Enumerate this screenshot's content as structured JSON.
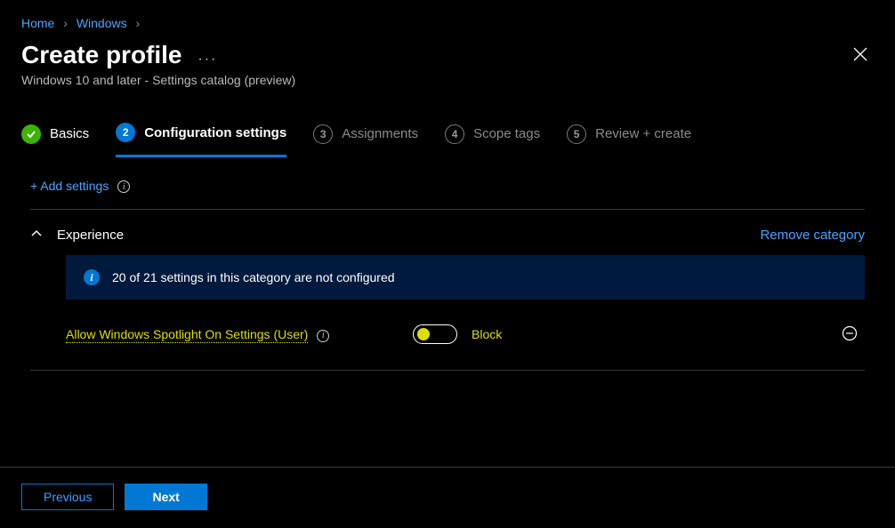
{
  "breadcrumb": {
    "items": [
      "Home",
      "Windows"
    ]
  },
  "header": {
    "title": "Create profile",
    "subtitle": "Windows 10 and later - Settings catalog (preview)"
  },
  "wizard": {
    "steps": [
      {
        "label": "Basics",
        "state": "done"
      },
      {
        "label": "Configuration settings",
        "state": "active",
        "number": "2"
      },
      {
        "label": "Assignments",
        "state": "pending",
        "number": "3"
      },
      {
        "label": "Scope tags",
        "state": "pending",
        "number": "4"
      },
      {
        "label": "Review + create",
        "state": "pending",
        "number": "5"
      }
    ]
  },
  "actions": {
    "add_settings": "+ Add settings"
  },
  "category": {
    "name": "Experience",
    "remove_label": "Remove category",
    "banner": "20 of 21 settings in this category are not configured",
    "settings": [
      {
        "label": "Allow Windows Spotlight On Settings (User)",
        "toggle_state": "off",
        "toggle_label": "Block"
      }
    ]
  },
  "footer": {
    "previous": "Previous",
    "next": "Next"
  }
}
